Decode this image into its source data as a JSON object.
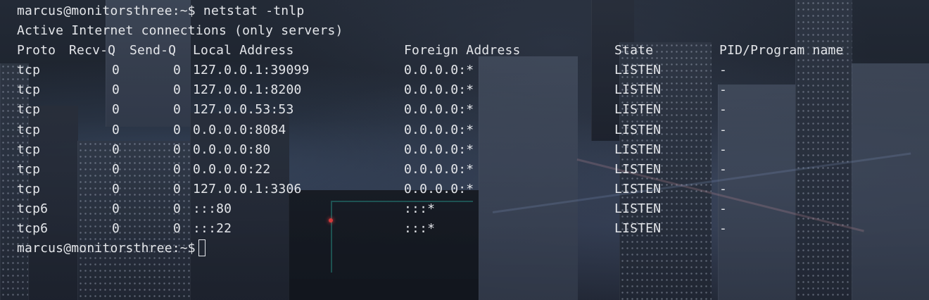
{
  "terminal": {
    "prompt": "marcus@monitorsthree:~$",
    "command": "netstat -tnlp",
    "header_line": "Active Internet connections (only servers)",
    "columns": {
      "proto": "Proto",
      "recv": "Recv-Q",
      "send": "Send-Q",
      "local": "Local Address",
      "foreign": "Foreign Address",
      "state": "State",
      "pid": "PID/Program name"
    },
    "rows": [
      {
        "proto": "tcp",
        "recv": "0",
        "send": "0",
        "local": "127.0.0.1:39099",
        "foreign": "0.0.0.0:*",
        "state": "LISTEN",
        "pid": "-"
      },
      {
        "proto": "tcp",
        "recv": "0",
        "send": "0",
        "local": "127.0.0.1:8200",
        "foreign": "0.0.0.0:*",
        "state": "LISTEN",
        "pid": "-"
      },
      {
        "proto": "tcp",
        "recv": "0",
        "send": "0",
        "local": "127.0.0.53:53",
        "foreign": "0.0.0.0:*",
        "state": "LISTEN",
        "pid": "-"
      },
      {
        "proto": "tcp",
        "recv": "0",
        "send": "0",
        "local": "0.0.0.0:8084",
        "foreign": "0.0.0.0:*",
        "state": "LISTEN",
        "pid": "-"
      },
      {
        "proto": "tcp",
        "recv": "0",
        "send": "0",
        "local": "0.0.0.0:80",
        "foreign": "0.0.0.0:*",
        "state": "LISTEN",
        "pid": "-"
      },
      {
        "proto": "tcp",
        "recv": "0",
        "send": "0",
        "local": "0.0.0.0:22",
        "foreign": "0.0.0.0:*",
        "state": "LISTEN",
        "pid": "-"
      },
      {
        "proto": "tcp",
        "recv": "0",
        "send": "0",
        "local": "127.0.0.1:3306",
        "foreign": "0.0.0.0:*",
        "state": "LISTEN",
        "pid": "-"
      },
      {
        "proto": "tcp6",
        "recv": "0",
        "send": "0",
        "local": ":::80",
        "foreign": ":::*",
        "state": "LISTEN",
        "pid": "-"
      },
      {
        "proto": "tcp6",
        "recv": "0",
        "send": "0",
        "local": ":::22",
        "foreign": ":::*",
        "state": "LISTEN",
        "pid": "-"
      }
    ],
    "final_prompt": "marcus@monitorsthree:~$",
    "text_color": "#e4e6ea",
    "background_color": "#151a22"
  }
}
